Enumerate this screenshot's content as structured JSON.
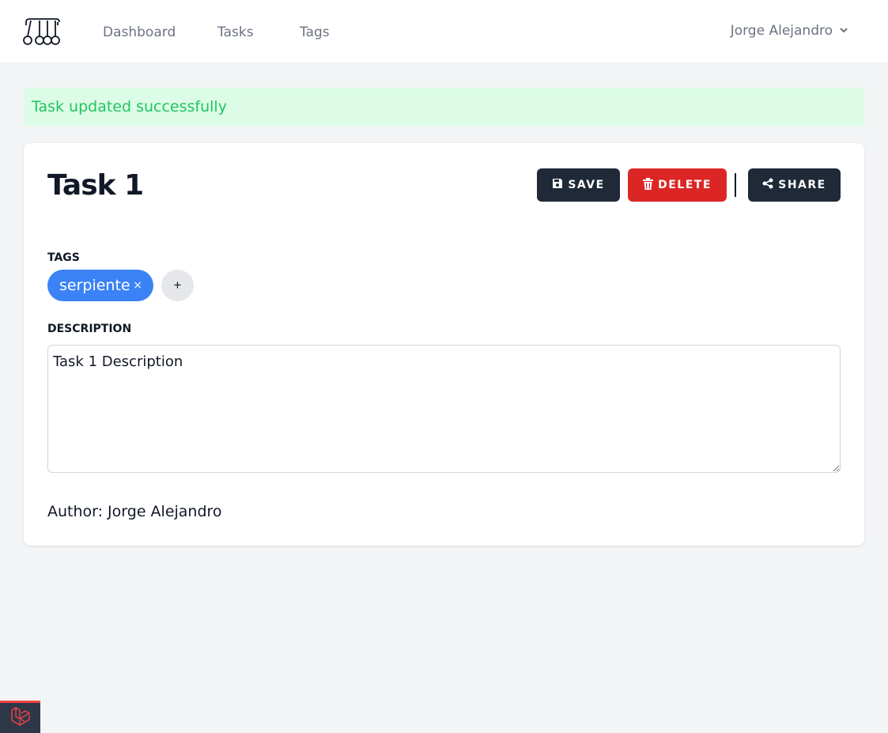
{
  "nav": {
    "links": [
      {
        "label": "Dashboard"
      },
      {
        "label": "Tasks"
      },
      {
        "label": "Tags"
      }
    ],
    "user_name": "Jorge Alejandro"
  },
  "flash": {
    "message": "Task updated successfully",
    "color": "#22c55e"
  },
  "task": {
    "title": "Task 1",
    "actions": {
      "save_label": "SAVE",
      "delete_label": "DELETE",
      "share_label": "SHARE"
    },
    "tags_label": "TAGS",
    "tags": [
      {
        "name": "serpiente",
        "remove_glyph": "×"
      }
    ],
    "add_tag_glyph": "+",
    "description_label": "DESCRIPTION",
    "description": "Task 1 Description",
    "author_label": "Author:",
    "author_name": "Jorge Alejandro"
  },
  "colors": {
    "primary_dark": "#1f2937",
    "danger": "#dc2626",
    "tag_blue": "#3b82f6",
    "success_bg": "#dcfce7",
    "laravel_red": "#ef4444"
  },
  "icons": {
    "logo": "newtons-cradle-icon",
    "user_menu": "chevron-down-icon",
    "save": "floppy-disk-icon",
    "delete": "trash-icon",
    "share": "share-icon",
    "debug_badge": "laravel-icon"
  }
}
